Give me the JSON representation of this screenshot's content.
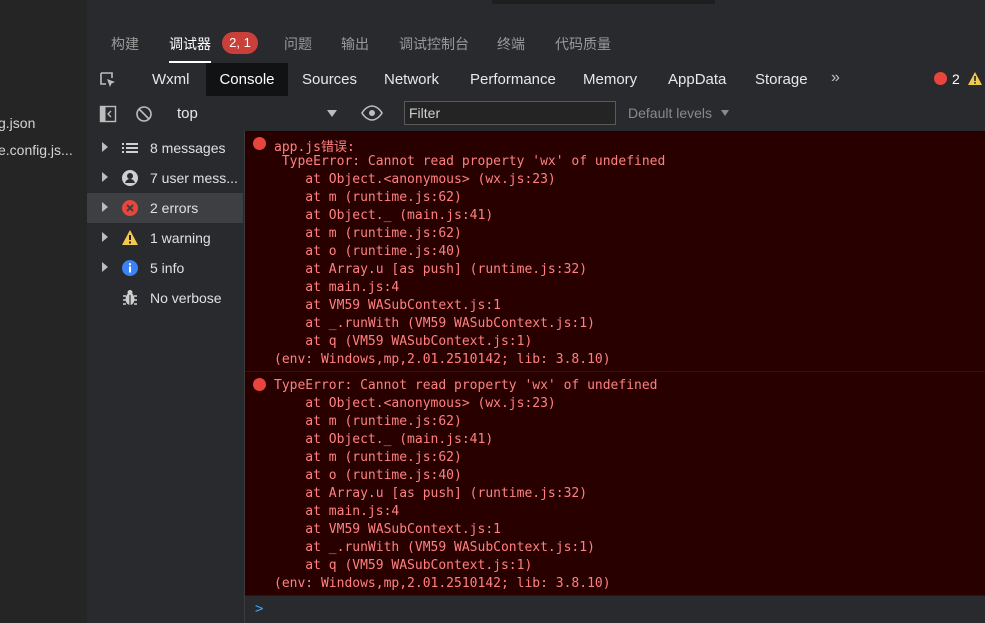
{
  "file_panel": {
    "items": [
      "g.json",
      "e.config.js..."
    ]
  },
  "panel_tabs": {
    "items": [
      "构建",
      "调试器",
      "问题",
      "输出",
      "调试控制台",
      "终端",
      "代码质量"
    ],
    "active": "调试器",
    "error_badge": "2, 1"
  },
  "devtools_tabs": {
    "items": [
      "Wxml",
      "Console",
      "Sources",
      "Network",
      "Performance",
      "Memory",
      "AppData",
      "Storage"
    ],
    "active": "Console",
    "more": "»",
    "error_count": "2"
  },
  "toolbar": {
    "context": "top",
    "filter_placeholder": "Filter",
    "levels": "Default levels"
  },
  "sidebar": {
    "items": [
      {
        "label": "8 messages",
        "icon": "list-icon"
      },
      {
        "label": "7 user mess...",
        "icon": "user-icon"
      },
      {
        "label": "2 errors",
        "icon": "error-icon"
      },
      {
        "label": "1 warning",
        "icon": "warning-icon"
      },
      {
        "label": "5 info",
        "icon": "info-icon"
      },
      {
        "label": "No verbose",
        "icon": "bug-icon"
      }
    ],
    "selected": "2 errors"
  },
  "console": {
    "errors": [
      {
        "lines": [
          "app.js错误:",
          " TypeError: Cannot read property 'wx' of undefined",
          "    at Object.<anonymous> (wx.js:23)",
          "    at m (runtime.js:62)",
          "    at Object._ (main.js:41)",
          "    at m (runtime.js:62)",
          "    at o (runtime.js:40)",
          "    at Array.u [as push] (runtime.js:32)",
          "    at main.js:4",
          "    at VM59 WASubContext.js:1",
          "    at _.runWith (VM59 WASubContext.js:1)",
          "    at q (VM59 WASubContext.js:1)",
          "(env: Windows,mp,2.01.2510142; lib: 3.8.10)"
        ]
      },
      {
        "lines": [
          "TypeError: Cannot read property 'wx' of undefined",
          "    at Object.<anonymous> (wx.js:23)",
          "    at m (runtime.js:62)",
          "    at Object._ (main.js:41)",
          "    at m (runtime.js:62)",
          "    at o (runtime.js:40)",
          "    at Array.u [as push] (runtime.js:32)",
          "    at main.js:4",
          "    at VM59 WASubContext.js:1",
          "    at _.runWith (VM59 WASubContext.js:1)",
          "    at q (VM59 WASubContext.js:1)",
          "(env: Windows,mp,2.01.2510142; lib: 3.8.10)"
        ]
      }
    ],
    "prompt": ">"
  },
  "colors": {
    "error_text": "#ff8080",
    "error_bg": "#290000",
    "badge": "#c9403a",
    "link": "#ffffff",
    "prompt": "#3ea6ff"
  }
}
